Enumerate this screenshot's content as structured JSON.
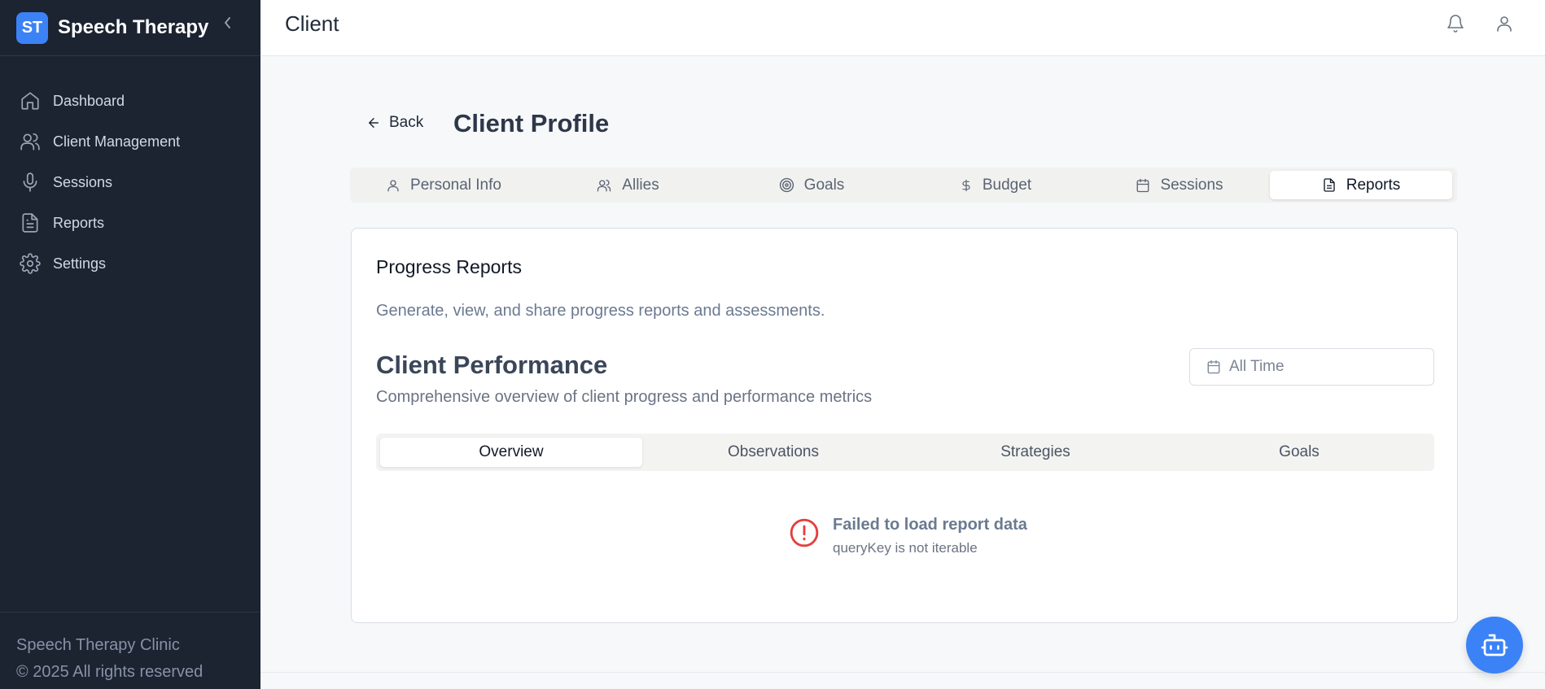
{
  "sidebar": {
    "brand_badge": "ST",
    "brand_name": "Speech Therapy",
    "items": [
      {
        "label": "Dashboard",
        "icon": "home-icon"
      },
      {
        "label": "Client Management",
        "icon": "users-icon"
      },
      {
        "label": "Sessions",
        "icon": "microphone-icon"
      },
      {
        "label": "Reports",
        "icon": "file-text-icon"
      },
      {
        "label": "Settings",
        "icon": "gear-icon"
      }
    ],
    "footer_line1": "Speech Therapy Clinic",
    "footer_line2": "© 2025 All rights reserved"
  },
  "header": {
    "title": "Client"
  },
  "profile": {
    "back_label": "Back",
    "title": "Client Profile",
    "tabs": [
      {
        "label": "Personal Info",
        "icon": "user-icon"
      },
      {
        "label": "Allies",
        "icon": "users-icon"
      },
      {
        "label": "Goals",
        "icon": "target-icon"
      },
      {
        "label": "Budget",
        "icon": "dollar-icon"
      },
      {
        "label": "Sessions",
        "icon": "calendar-icon"
      },
      {
        "label": "Reports",
        "icon": "file-text-icon",
        "active": true
      }
    ]
  },
  "reports": {
    "title": "Progress Reports",
    "description": "Generate, view, and share progress reports and assessments.",
    "performance_title": "Client Performance",
    "performance_description": "Comprehensive overview of client progress and performance metrics",
    "date_range": "All Time",
    "subtabs": [
      {
        "label": "Overview",
        "active": true
      },
      {
        "label": "Observations"
      },
      {
        "label": "Strategies"
      },
      {
        "label": "Goals"
      }
    ],
    "error_title": "Failed to load report data",
    "error_message": "queryKey is not iterable"
  },
  "colors": {
    "accent": "#3b82f6",
    "sidebar_bg": "#1c2331",
    "error": "#e53e3e"
  }
}
